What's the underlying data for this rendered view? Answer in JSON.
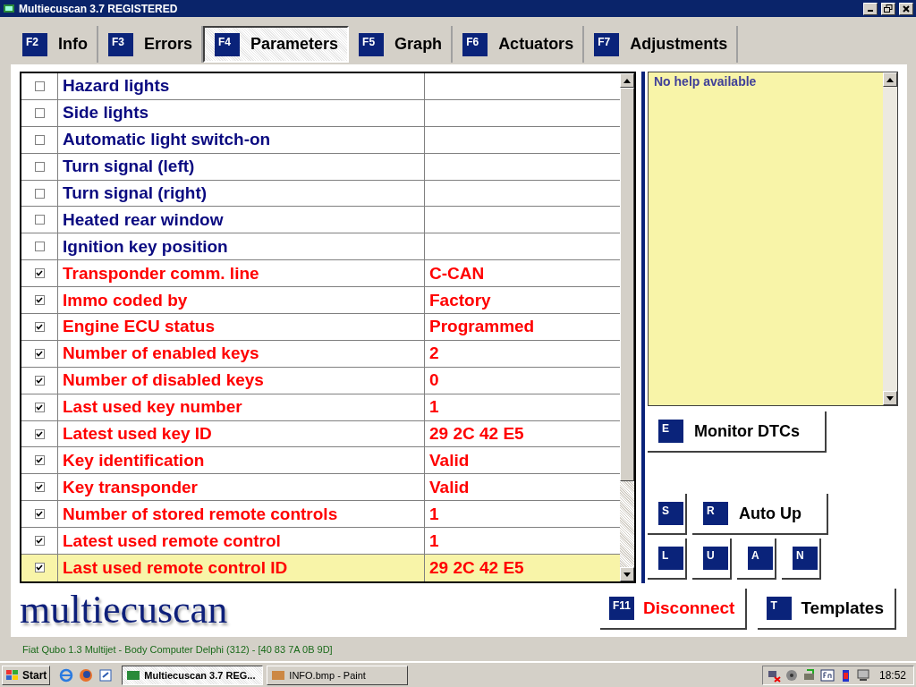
{
  "window": {
    "title": "Multiecuscan 3.7 REGISTERED"
  },
  "tabs": [
    {
      "key": "F2",
      "label": "Info",
      "selected": false
    },
    {
      "key": "F3",
      "label": "Errors",
      "selected": false
    },
    {
      "key": "F4",
      "label": "Parameters",
      "selected": true
    },
    {
      "key": "F5",
      "label": "Graph",
      "selected": false
    },
    {
      "key": "F6",
      "label": "Actuators",
      "selected": false
    },
    {
      "key": "F7",
      "label": "Adjustments",
      "selected": false
    }
  ],
  "parameters": [
    {
      "name": "Hazard lights",
      "checked": false,
      "selected": false
    },
    {
      "name": "Side lights",
      "checked": false,
      "selected": false
    },
    {
      "name": "Automatic light switch-on",
      "checked": false,
      "selected": false
    },
    {
      "name": "Turn signal (left)",
      "checked": false,
      "selected": false
    },
    {
      "name": "Turn signal (right)",
      "checked": false,
      "selected": false
    },
    {
      "name": "Heated rear window",
      "checked": false,
      "selected": false
    },
    {
      "name": "Ignition key position",
      "checked": false,
      "selected": false
    },
    {
      "name": "Transponder comm. line",
      "value": "C-CAN",
      "checked": true,
      "selected": false
    },
    {
      "name": "Immo coded by",
      "value": "Factory",
      "checked": true,
      "selected": false
    },
    {
      "name": "Engine ECU status",
      "value": "Programmed",
      "checked": true,
      "selected": false
    },
    {
      "name": "Number of enabled keys",
      "value": "2",
      "checked": true,
      "selected": false
    },
    {
      "name": "Number of disabled keys",
      "value": "0",
      "checked": true,
      "selected": false
    },
    {
      "name": "Last used key number",
      "value": "1",
      "checked": true,
      "selected": false
    },
    {
      "name": "Latest used key ID",
      "value": "29 2C 42 E5",
      "checked": true,
      "selected": false
    },
    {
      "name": "Key identification",
      "value": "Valid",
      "checked": true,
      "selected": false
    },
    {
      "name": "Key transponder",
      "value": "Valid",
      "checked": true,
      "selected": false
    },
    {
      "name": "Number of stored remote controls",
      "value": "1",
      "checked": true,
      "selected": false
    },
    {
      "name": "Latest used remote control",
      "value": "1",
      "checked": true,
      "selected": false
    },
    {
      "name": "Last used remote control ID",
      "value": "29 2C 42 E5",
      "checked": true,
      "selected": true
    }
  ],
  "help": {
    "text": "No help available"
  },
  "monitor_button": {
    "key": "E",
    "label": "Monitor DTCs"
  },
  "auto_row": [
    {
      "key": "S"
    },
    {
      "key": "R",
      "label": "Auto Up"
    }
  ],
  "key_row": [
    {
      "key": "L"
    },
    {
      "key": "U"
    },
    {
      "key": "A"
    },
    {
      "key": "N"
    }
  ],
  "logo": "multiecuscan",
  "bottom_buttons": [
    {
      "key": "F11",
      "label": "Disconnect",
      "kind": "warning"
    },
    {
      "key": "T",
      "label": "Templates",
      "kind": "normal"
    }
  ],
  "status_bar": "Fiat Qubo 1.3 Multijet - Body Computer Delphi (312) - [40 83 7A 0B 9D]",
  "taskbar": {
    "start": "Start",
    "tasks": [
      {
        "label": "Multiecuscan 3.7 REG...",
        "selected": true
      },
      {
        "label": "INFO.bmp - Paint",
        "selected": false
      }
    ],
    "clock": "18:52"
  }
}
